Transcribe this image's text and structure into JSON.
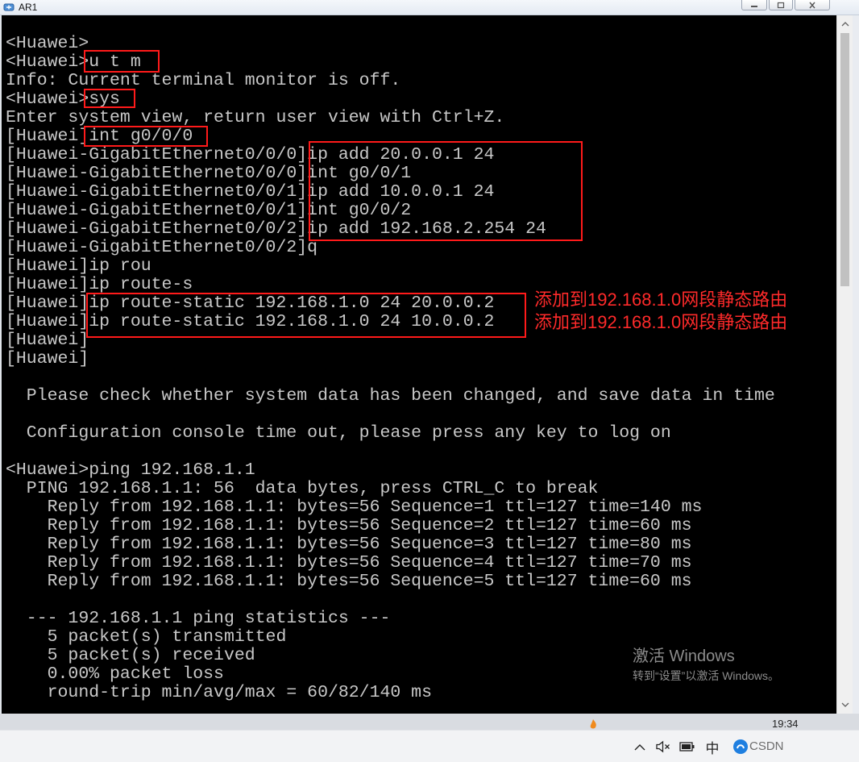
{
  "window": {
    "title": "AR1"
  },
  "terminal": {
    "lines": [
      "<Huawei>",
      "<Huawei>u t m",
      "Info: Current terminal monitor is off.",
      "<Huawei>sys",
      "Enter system view, return user view with Ctrl+Z.",
      "[Huawei]int g0/0/0",
      "[Huawei-GigabitEthernet0/0/0]ip add 20.0.0.1 24",
      "[Huawei-GigabitEthernet0/0/0]int g0/0/1",
      "[Huawei-GigabitEthernet0/0/1]ip add 10.0.0.1 24",
      "[Huawei-GigabitEthernet0/0/1]int g0/0/2",
      "[Huawei-GigabitEthernet0/0/2]ip add 192.168.2.254 24",
      "[Huawei-GigabitEthernet0/0/2]q",
      "[Huawei]ip rou",
      "[Huawei]ip route-s",
      "[Huawei]ip route-static 192.168.1.0 24 20.0.0.2",
      "[Huawei]ip route-static 192.168.1.0 24 10.0.0.2",
      "[Huawei]",
      "[Huawei]",
      "",
      "  Please check whether system data has been changed, and save data in time",
      "",
      "  Configuration console time out, please press any key to log on",
      "",
      "<Huawei>ping 192.168.1.1",
      "  PING 192.168.1.1: 56  data bytes, press CTRL_C to break",
      "    Reply from 192.168.1.1: bytes=56 Sequence=1 ttl=127 time=140 ms",
      "    Reply from 192.168.1.1: bytes=56 Sequence=2 ttl=127 time=60 ms",
      "    Reply from 192.168.1.1: bytes=56 Sequence=3 ttl=127 time=80 ms",
      "    Reply from 192.168.1.1: bytes=56 Sequence=4 ttl=127 time=70 ms",
      "    Reply from 192.168.1.1: bytes=56 Sequence=5 ttl=127 time=60 ms",
      "",
      "  --- 192.168.1.1 ping statistics ---",
      "    5 packet(s) transmitted",
      "    5 packet(s) received",
      "    0.00% packet loss",
      "    round-trip min/avg/max = 60/82/140 ms"
    ]
  },
  "annotations": [
    "添加到192.168.1.0网段静态路由",
    "添加到192.168.1.0网段静态路由"
  ],
  "activation_watermark": {
    "title": "激活 Windows",
    "subtitle": "转到“设置”以激活 Windows。"
  },
  "taskbar": {
    "clock": "19:34",
    "ime": "中",
    "watermark": "CSDN"
  },
  "icons": {
    "app": "router-app-icon",
    "minimize": "minimize-icon",
    "maximize": "maximize-icon",
    "close": "close-icon",
    "scroll_up": "scroll-up-arrow-icon",
    "scroll_down": "scroll-down-arrow-icon",
    "weather": "weather-icon",
    "tray_expand": "chevron-up-icon",
    "volume": "speaker-muted-icon",
    "power": "battery-icon",
    "tray_app": "blue-app-icon"
  },
  "colors": {
    "terminal_bg": "#000000",
    "terminal_text": "#c8c8c8",
    "highlight": "#ff1a1a",
    "annotation": "#ff2a2a"
  }
}
